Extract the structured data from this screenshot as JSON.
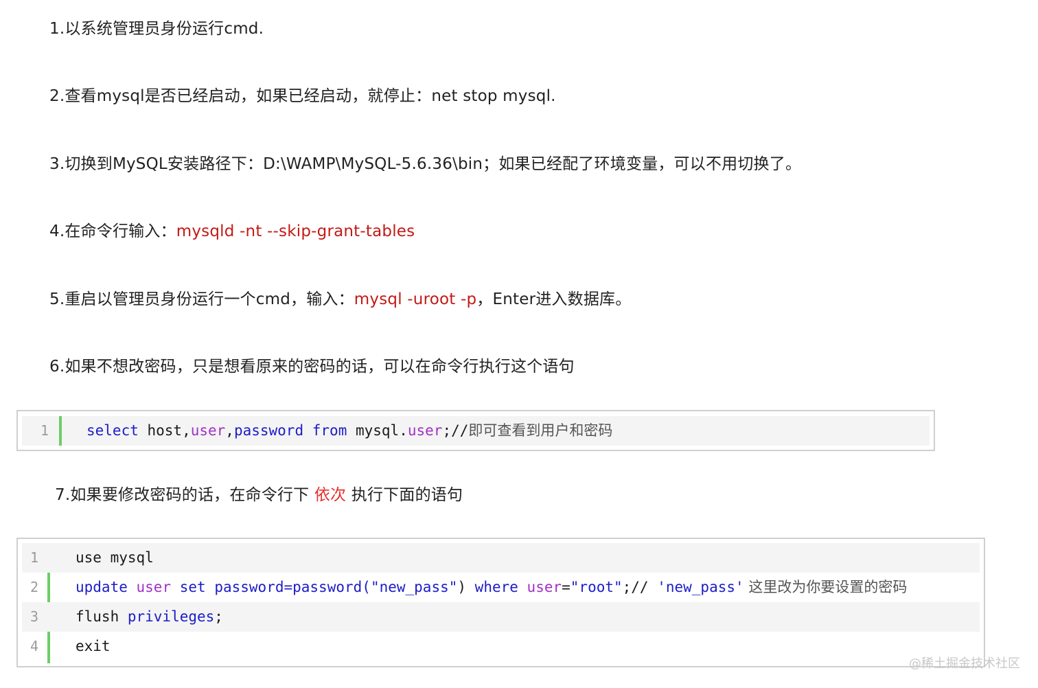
{
  "steps": {
    "s1": "1.以系统管理员身份运行cmd.",
    "s2": "2.查看mysql是否已经启动，如果已经启动，就停止：net stop mysql.",
    "s3": "3.切换到MySQL安装路径下：D:\\WAMP\\MySQL-5.6.36\\bin；如果已经配了环境变量，可以不用切换了。",
    "s4_prefix": "4.在命令行输入：",
    "s4_cmd": "mysqld -nt --skip-grant-tables",
    "s5_prefix": "5.重启以管理员身份运行一个cmd，输入：",
    "s5_cmd": "mysql -uroot -p",
    "s5_suffix": "，Enter进入数据库。",
    "s6": "6.如果不想改密码，只是想看原来的密码的话，可以在命令行执行这个语句",
    "s7_prefix": "7.如果要修改密码的话，在命令行下 ",
    "s7_emph": "依次",
    "s7_suffix": " 执行下面的语句"
  },
  "code1": {
    "line_no": "1",
    "t_select": "select",
    "t_host": " host,",
    "t_user": "user",
    "t_comma": ",",
    "t_password": "password",
    "t_sp": " ",
    "t_from": "from",
    "t_mysql": " mysql.",
    "t_user2": "user",
    "t_semi": ";//",
    "t_comment": "即可查看到用户和密码"
  },
  "code2": {
    "l1": {
      "no": "1",
      "text": "use mysql"
    },
    "l2": {
      "no": "2",
      "t_update": "update",
      "t_sp1": " ",
      "t_user": "user",
      "t_sp2": " ",
      "t_set": "set",
      "t_pw": " password=",
      "t_pwfn": "password",
      "t_paren1": "(",
      "t_newpass": "\"new_pass\"",
      "t_paren2": ") ",
      "t_where": "where",
      "t_sp3": " ",
      "t_user2": "user",
      "t_eq": "=",
      "t_root": "\"root\"",
      "t_semi": ";// ",
      "t_q": "'new_pass'",
      "t_comment": " 这里改为你要设置的密码"
    },
    "l3": {
      "no": "3",
      "t_flush": "flush ",
      "t_priv": "privileges",
      "t_semi": ";"
    },
    "l4": {
      "no": "4",
      "text": "exit"
    }
  },
  "watermark": "@稀土掘金技术社区",
  "colors": {
    "command_red": "#c41a16",
    "emph_red": "#e62e2e",
    "keyword_blue": "#1c1cc8",
    "builtin_purple": "#a031c6",
    "gutter_green": "#6cce68"
  }
}
